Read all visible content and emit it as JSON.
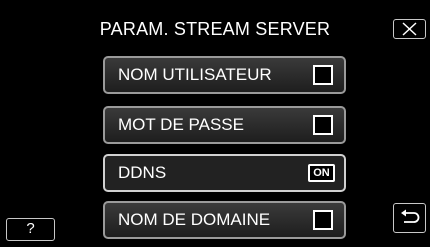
{
  "header": {
    "title": "PARAM. STREAM SERVER",
    "close_icon": "close-icon"
  },
  "menu": {
    "items": [
      {
        "label": "NOM UTILISATEUR",
        "control": "checkbox",
        "checked": false
      },
      {
        "label": "MOT DE PASSE",
        "control": "checkbox",
        "checked": false
      },
      {
        "label": "DDNS",
        "control": "badge",
        "value": "ON"
      },
      {
        "label": "NOM DE DOMAINE",
        "control": "checkbox",
        "checked": false
      }
    ]
  },
  "footer": {
    "help_label": "?",
    "back_icon": "back-arrow-icon"
  },
  "colors": {
    "background": "#000000",
    "button_border": "#9a9a9a",
    "text": "#ffffff"
  }
}
